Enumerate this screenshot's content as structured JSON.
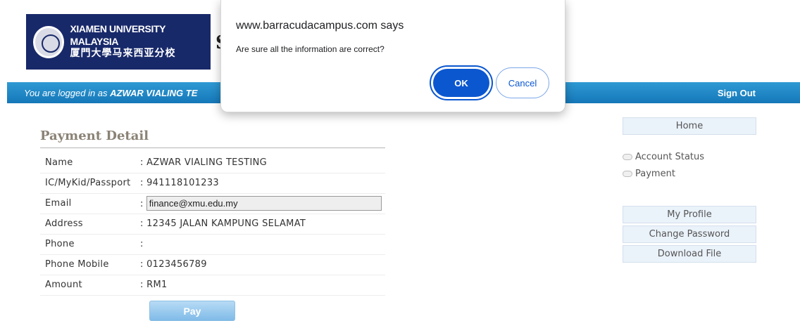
{
  "header": {
    "logo_en": "XIAMEN UNIVERSITY MALAYSIA",
    "logo_cn": "厦門大學马来西亚分校",
    "site_initial": "S"
  },
  "topbar": {
    "login_prefix": "You are logged in as ",
    "login_user": "AZWAR VIALING TE",
    "signout": "Sign Out"
  },
  "payment": {
    "title": "Payment Detail",
    "rows": [
      {
        "label": "Name",
        "value": ": AZWAR VIALING TESTING"
      },
      {
        "label": "IC/MyKid/Passport",
        "value": ": 941118101233"
      },
      {
        "label": "Email",
        "prefix": ":",
        "input_value": "finance@xmu.edu.my"
      },
      {
        "label": "Address",
        "value": ": 12345 JALAN KAMPUNG SELAMAT"
      },
      {
        "label": "Phone",
        "value": ":"
      },
      {
        "label": "Phone Mobile",
        "value": ": 0123456789"
      },
      {
        "label": "Amount",
        "value": ": RM1"
      }
    ],
    "pay_label": "Pay"
  },
  "sidebar": {
    "home": "Home",
    "links": [
      "Account Status",
      "Payment"
    ],
    "buttons": [
      "My Profile",
      "Change Password",
      "Download File"
    ]
  },
  "dialog": {
    "title": "www.barracudacampus.com says",
    "message": "Are sure all the information are correct?",
    "ok": "OK",
    "cancel": "Cancel"
  },
  "colors": {
    "brand_navy": "#18296a",
    "topbar_blue": "#1577b8",
    "dialog_ok": "#0b57d0"
  }
}
